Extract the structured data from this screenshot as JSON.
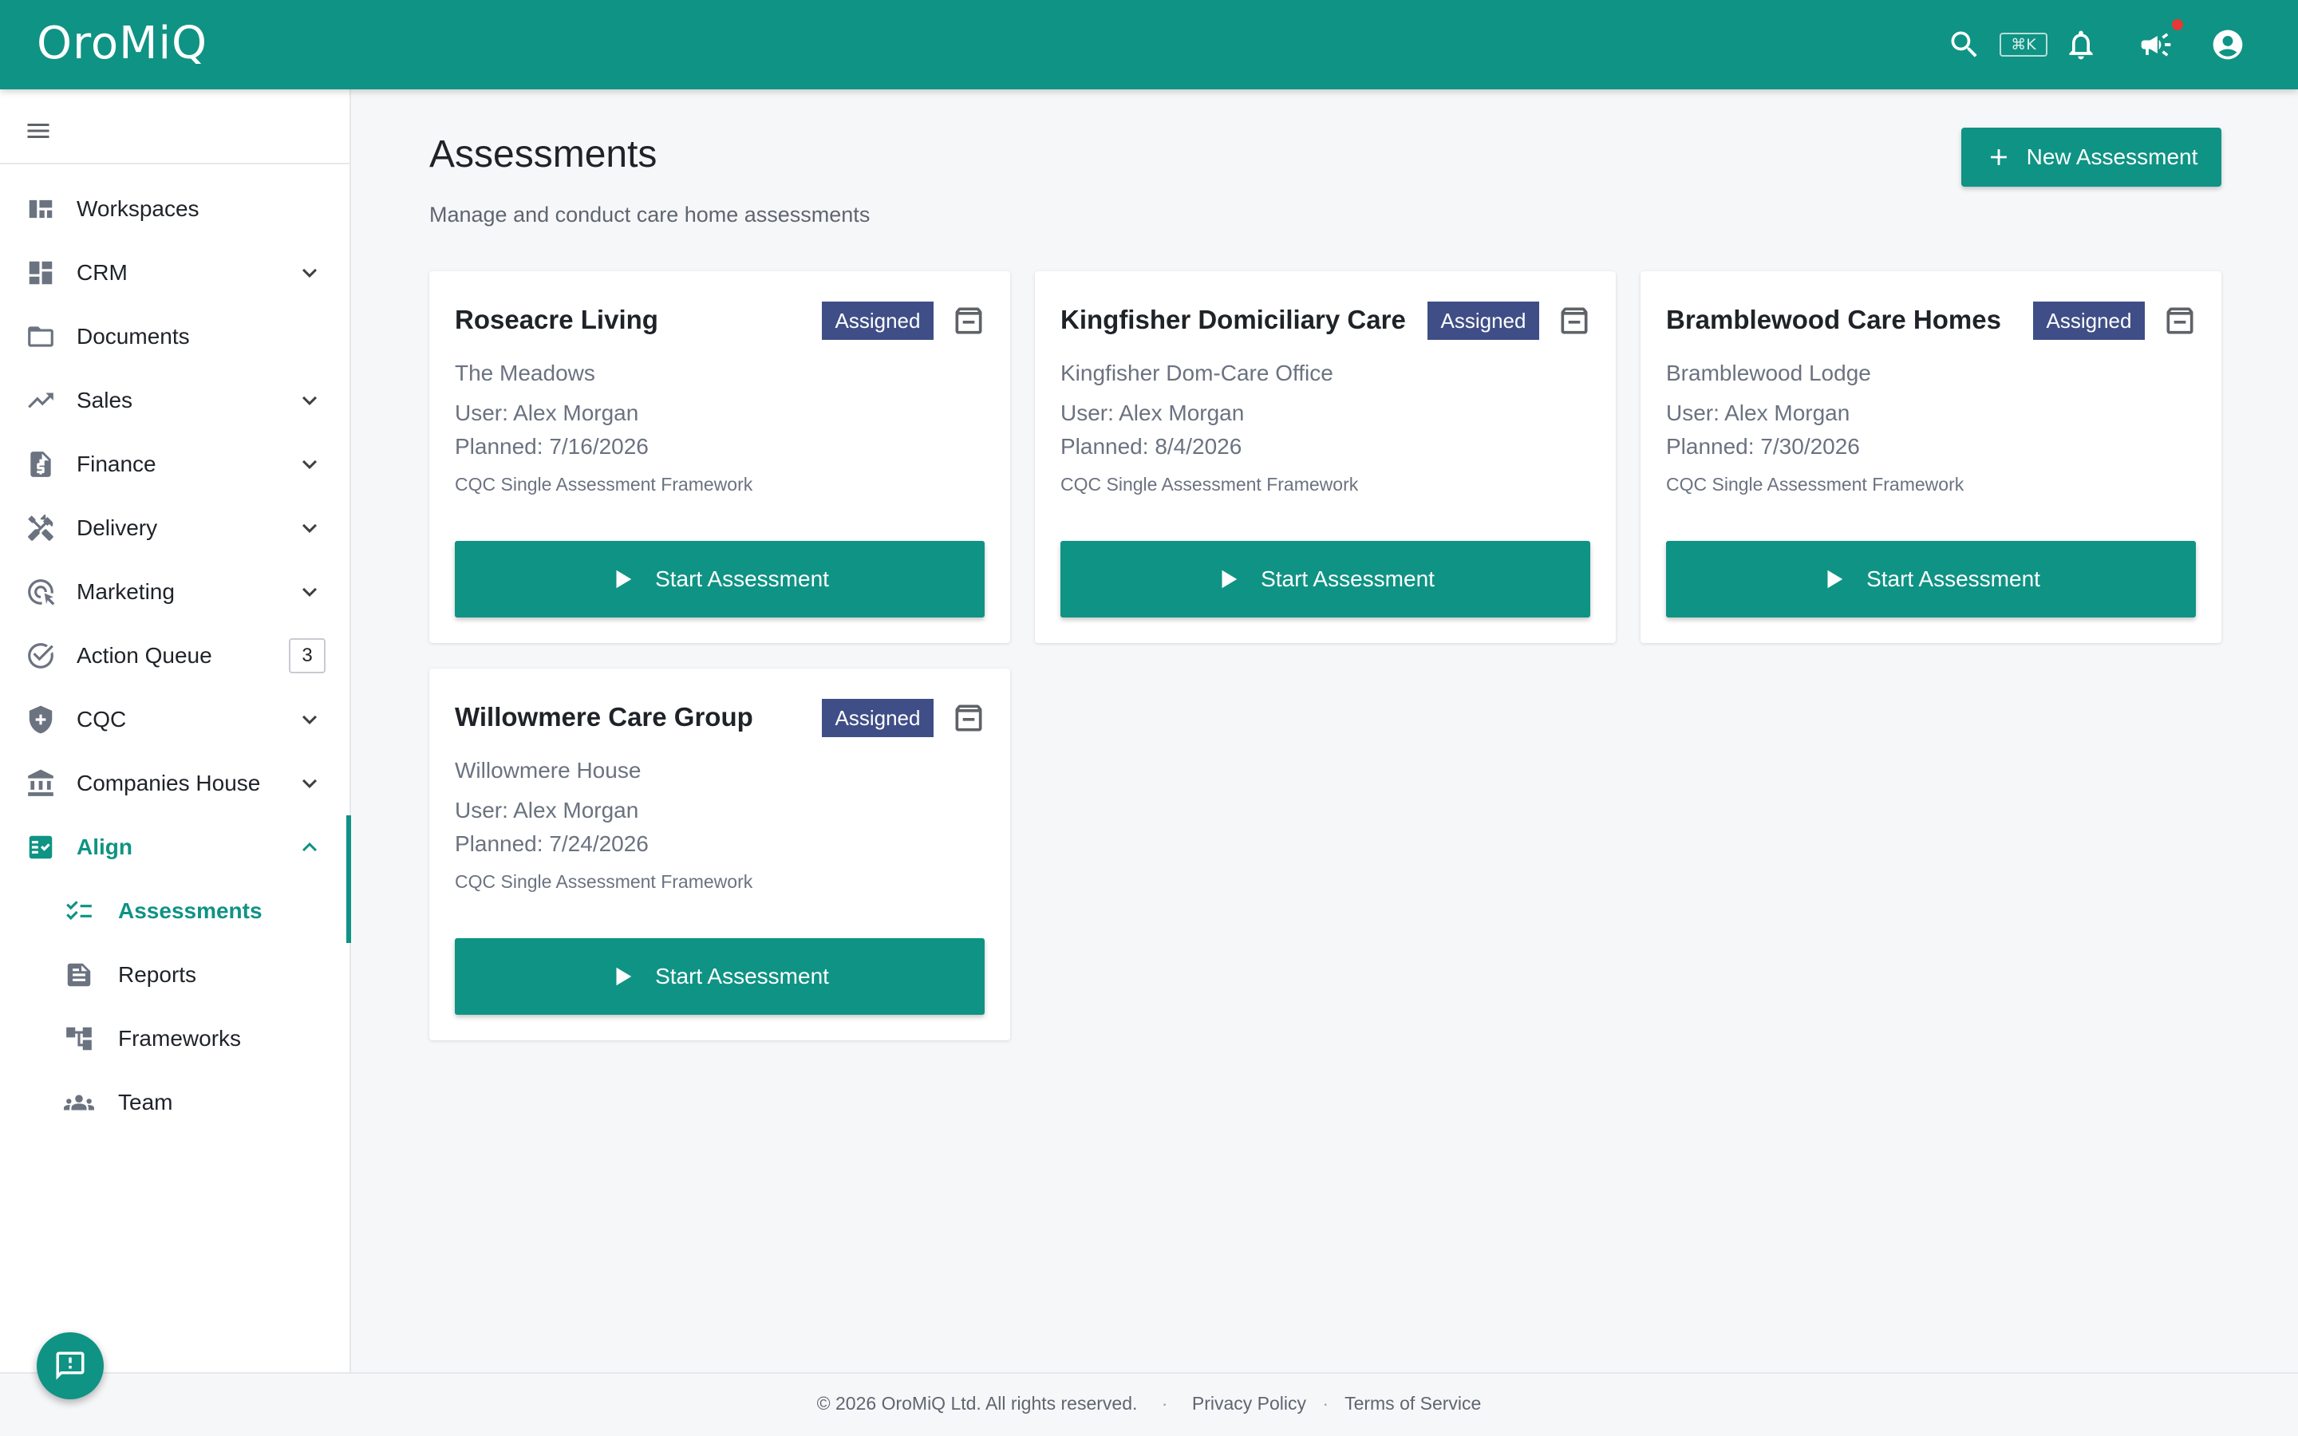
{
  "app": {
    "logo": "OroMiQ"
  },
  "topbar": {
    "shortcut": "⌘K",
    "icons": [
      "search-icon",
      "notifications-icon",
      "announcements-icon",
      "account-icon"
    ]
  },
  "sidebar": {
    "items": [
      {
        "label": "Workspaces",
        "icon": "workspaces-icon"
      },
      {
        "label": "CRM",
        "icon": "dashboard-icon"
      },
      {
        "label": "Documents",
        "icon": "folder-icon"
      },
      {
        "label": "Sales",
        "icon": "trending-up-icon"
      },
      {
        "label": "Finance",
        "icon": "invoice-icon"
      },
      {
        "label": "Delivery",
        "icon": "tools-icon"
      },
      {
        "label": "Marketing",
        "icon": "target-icon"
      },
      {
        "label": "Action Queue",
        "icon": "check-circle-icon",
        "badge": "3"
      },
      {
        "label": "CQC",
        "icon": "shield-icon"
      },
      {
        "label": "Companies House",
        "icon": "bank-icon"
      },
      {
        "label": "Align",
        "icon": "checklist-icon"
      }
    ],
    "sub_items": [
      {
        "label": "Assessments",
        "icon": "checklist-lines-icon"
      },
      {
        "label": "Reports",
        "icon": "report-icon"
      },
      {
        "label": "Frameworks",
        "icon": "hierarchy-icon"
      },
      {
        "label": "Team",
        "icon": "people-icon"
      }
    ]
  },
  "main": {
    "title": "Assessments",
    "subtitle": "Manage and conduct care home assessments",
    "new_button": "New Assessment",
    "cards": [
      {
        "name": "Roseacre Living",
        "status": "Assigned",
        "location": "The Meadows",
        "user": "User: Alex Morgan",
        "planned": "Planned: 7/16/2026",
        "framework": "CQC Single Assessment Framework",
        "action": "Start Assessment"
      },
      {
        "name": "Kingfisher Domiciliary Care",
        "status": "Assigned",
        "location": "Kingfisher Dom-Care Office",
        "user": "User: Alex Morgan",
        "planned": "Planned: 8/4/2026",
        "framework": "CQC Single Assessment Framework",
        "action": "Start Assessment"
      },
      {
        "name": "Bramblewood Care Homes",
        "status": "Assigned",
        "location": "Bramblewood Lodge",
        "user": "User: Alex Morgan",
        "planned": "Planned: 7/30/2026",
        "framework": "CQC Single Assessment Framework",
        "action": "Start Assessment"
      },
      {
        "name": "Willowmere Care Group",
        "status": "Assigned",
        "location": "Willowmere House",
        "user": "User: Alex Morgan",
        "planned": "Planned: 7/24/2026",
        "framework": "CQC Single Assessment Framework",
        "action": "Start Assessment"
      }
    ]
  },
  "footer": {
    "copyright": "© 2026 OroMiQ Ltd. All rights reserved.",
    "privacy": "Privacy Policy",
    "terms": "Terms of Service"
  },
  "colors": {
    "brand": "#0f9384",
    "status_badge": "#3f4e86",
    "notification_dot": "#e53935"
  }
}
